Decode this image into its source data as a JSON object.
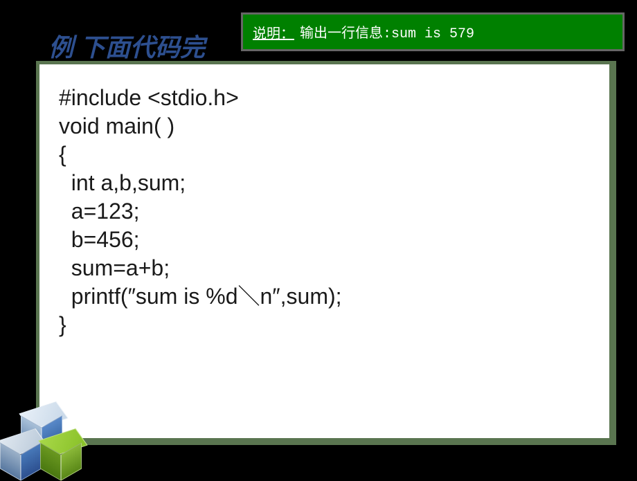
{
  "title": "例  下面代码完",
  "explanation": {
    "label": "说明：",
    "text": " 输出一行信息:sum is 579"
  },
  "code": {
    "line1": "#include <stdio.h>",
    "line2": "void main( )",
    "line3": "{",
    "line4": "  int a,b,sum;",
    "line5": "  a=123;",
    "line6": "  b=456;",
    "line7": "  sum=a+b;",
    "line8": "  printf(″sum is %d＼n″,sum);",
    "line9": "}"
  }
}
